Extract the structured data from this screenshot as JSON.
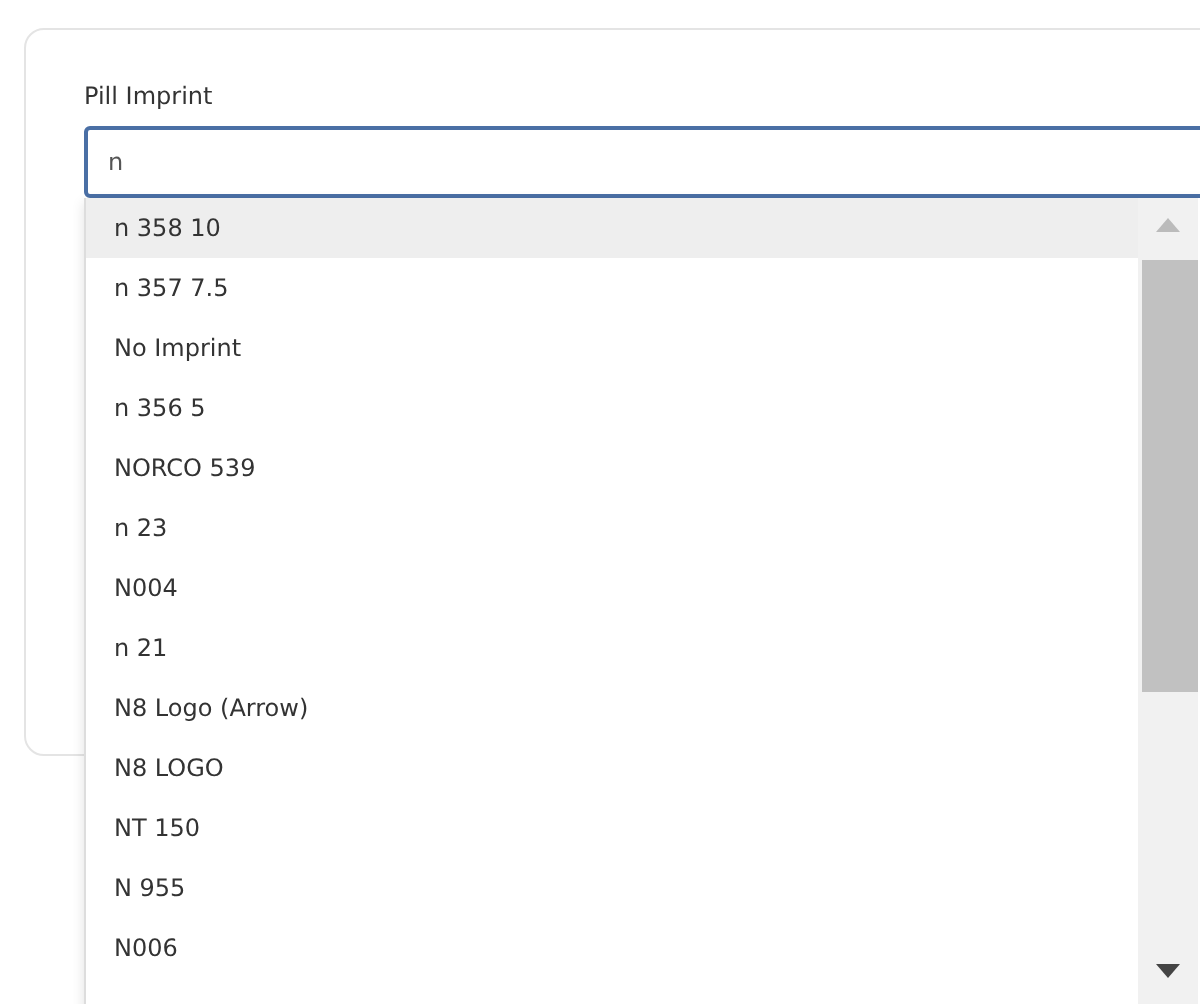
{
  "field": {
    "label": "Pill Imprint",
    "value": "n"
  },
  "options": [
    {
      "label": "n 358 10",
      "selected": true
    },
    {
      "label": "n 357 7.5",
      "selected": false
    },
    {
      "label": "No Imprint",
      "selected": false
    },
    {
      "label": "n 356 5",
      "selected": false
    },
    {
      "label": "NORCO 539",
      "selected": false
    },
    {
      "label": "n 23",
      "selected": false
    },
    {
      "label": "N004",
      "selected": false
    },
    {
      "label": "n 21",
      "selected": false
    },
    {
      "label": "N8 Logo (Arrow)",
      "selected": false
    },
    {
      "label": "N8 LOGO",
      "selected": false
    },
    {
      "label": "NT 150",
      "selected": false
    },
    {
      "label": "N 955",
      "selected": false
    },
    {
      "label": "N006",
      "selected": false
    }
  ]
}
